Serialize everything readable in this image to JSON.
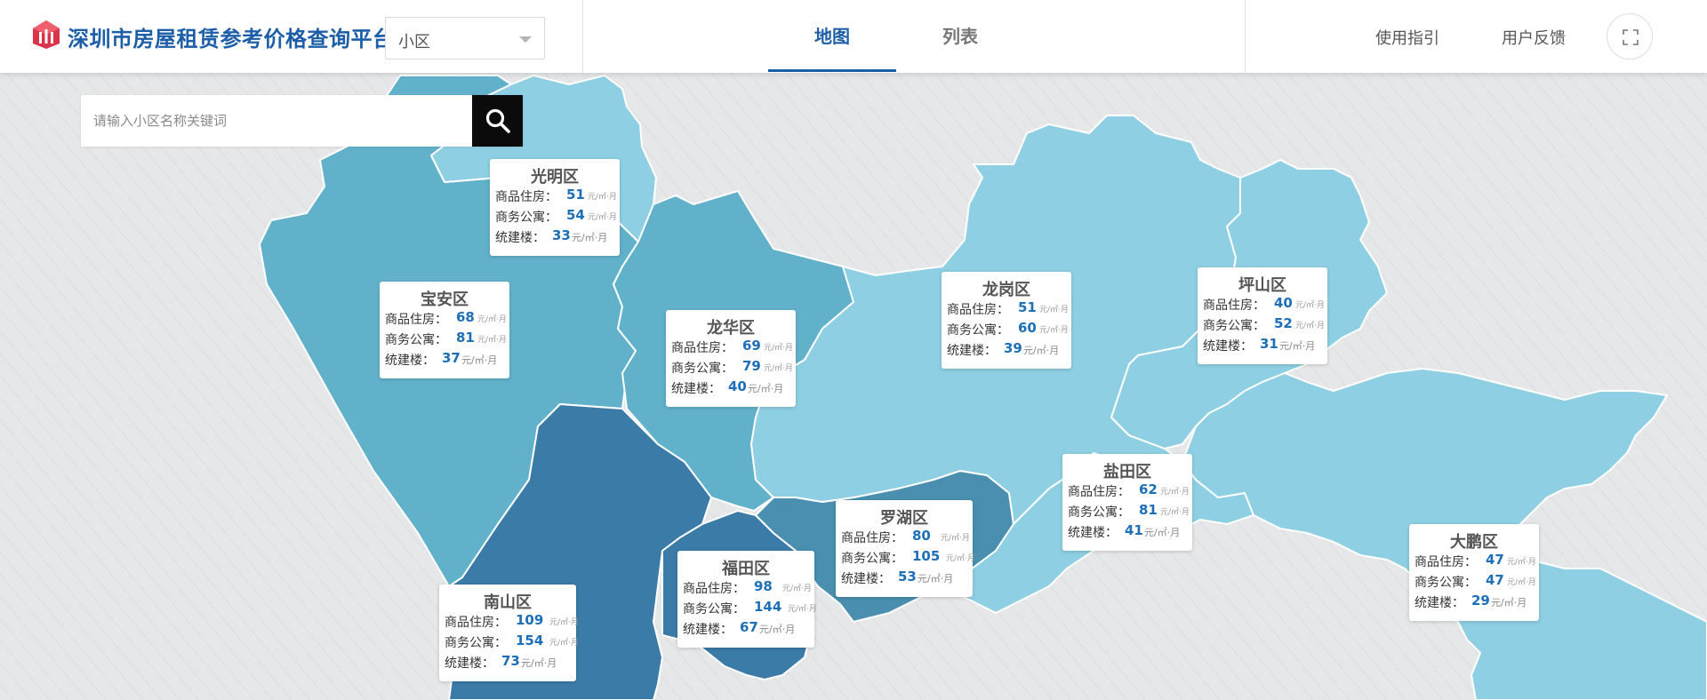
{
  "header": {
    "app_title": "深圳市房屋租赁参考价格查询平台",
    "type_select": "小区",
    "tabs": [
      {
        "label": "地图",
        "active": true
      },
      {
        "label": "列表",
        "active": false
      }
    ],
    "links": {
      "guide": "使用指引",
      "feedback": "用户反馈"
    },
    "icons": {
      "logo": "house-logo-icon",
      "fullscreen": "fullscreen-icon",
      "caret": "chevron-down-icon"
    }
  },
  "search": {
    "placeholder": "请输入小区名称关键词",
    "value": "",
    "icon": "search-icon"
  },
  "labels": {
    "residential": "商品住房：",
    "apartment": "商务公寓：",
    "collective": "统建楼：",
    "unit_small": "元/㎡·月",
    "unit": "元/㎡·月"
  },
  "colors": {
    "brand": "#1d5ea9",
    "value": "#1d6fb8",
    "map_light": "#8ecfe3",
    "map_mid": "#62b1cb",
    "map_dark": "#4a8fb0",
    "map_darkest": "#3b7ba8"
  },
  "districts": [
    {
      "name": "光明区",
      "residential": "51",
      "apartment": "54",
      "collective": "33"
    },
    {
      "name": "宝安区",
      "residential": "68",
      "apartment": "81",
      "collective": "37"
    },
    {
      "name": "龙华区",
      "residential": "69",
      "apartment": "79",
      "collective": "40"
    },
    {
      "name": "龙岗区",
      "residential": "51",
      "apartment": "60",
      "collective": "39"
    },
    {
      "name": "坪山区",
      "residential": "40",
      "apartment": "52",
      "collective": "31"
    },
    {
      "name": "盐田区",
      "residential": "62",
      "apartment": "81",
      "collective": "41"
    },
    {
      "name": "罗湖区",
      "residential": "80",
      "apartment": "105",
      "collective": "53"
    },
    {
      "name": "福田区",
      "residential": "98",
      "apartment": "144",
      "collective": "67"
    },
    {
      "name": "南山区",
      "residential": "109",
      "apartment": "154",
      "collective": "73"
    },
    {
      "name": "大鹏区",
      "residential": "47",
      "apartment": "47",
      "collective": "29"
    }
  ]
}
